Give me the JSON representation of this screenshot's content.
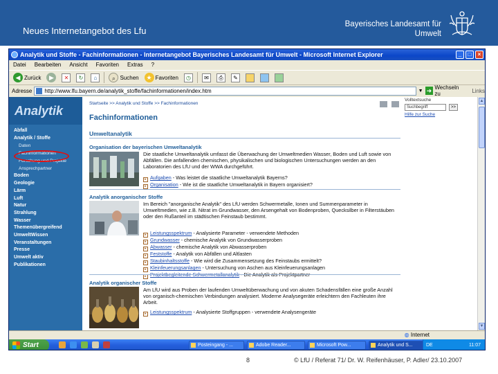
{
  "slide": {
    "title": "Neues Internetangebot des Lfu",
    "org_line1": "Bayerisches Landesamt für",
    "org_line2": "Umwelt",
    "page_number": "8",
    "footer": "© LfU / Referat 71/ Dr. W. Reifenhäuser, P. Adler/ 23.10.2007"
  },
  "browser": {
    "title": "Analytik und Stoffe - Fachinformationen - Internetangebot Bayerisches Landesamt für Umwelt - Microsoft Internet Explorer",
    "menu": [
      "Datei",
      "Bearbeiten",
      "Ansicht",
      "Favoriten",
      "Extras",
      "?"
    ],
    "toolbar": {
      "back": "Zurück",
      "search": "Suchen",
      "favorites": "Favoriten"
    },
    "address_label": "Adresse",
    "address": "http://www.lfu.bayern.de/analytik_stoffe/fachinformationen/index.htm",
    "go_label": "Wechseln zu",
    "links_label": "Links",
    "status_text": "",
    "status_zone": "Internet"
  },
  "page": {
    "nav_brand": "Analytik",
    "nav_items": [
      {
        "label": "Abfall",
        "type": "main"
      },
      {
        "label": "Analytik / Stoffe",
        "type": "main"
      },
      {
        "label": "Daten",
        "type": "sub"
      },
      {
        "label": "Fachinformationen",
        "type": "sub"
      },
      {
        "label": "Forschung und Projekte",
        "type": "sub"
      },
      {
        "label": "Ansprechpartner",
        "type": "sub"
      },
      {
        "label": "Boden",
        "type": "main"
      },
      {
        "label": "Geologie",
        "type": "main"
      },
      {
        "label": "Lärm",
        "type": "main"
      },
      {
        "label": "Luft",
        "type": "main"
      },
      {
        "label": "Natur",
        "type": "main"
      },
      {
        "label": "Strahlung",
        "type": "main"
      },
      {
        "label": "Wasser",
        "type": "main"
      },
      {
        "label": "Themenübergreifend",
        "type": "main"
      },
      {
        "label": "UmweltWissen",
        "type": "main"
      },
      {
        "label": "Veranstaltungen",
        "type": "main"
      },
      {
        "label": "Presse",
        "type": "main"
      },
      {
        "label": "Umwelt aktiv",
        "type": "main"
      },
      {
        "label": "Publikationen",
        "type": "main"
      }
    ],
    "breadcrumb": "Startseite >> Analytik und Stoffe >> Fachinformationen",
    "heading": "Fachinformationen",
    "fulltext_label": "Volltextsuche",
    "fulltext_placeholder": "Suchbegriff",
    "fulltext_button": ">>",
    "fulltext_help": "Hilfe zur Suche",
    "umweltanalytik_title": "Umweltanalytik",
    "sections": [
      {
        "title": "Organisation der bayerischen Umweltanalytik",
        "text": "Die staatliche Umweltanalytik umfasst die Überwachung der Umweltmedien Wasser, Boden und Luft sowie von Abfällen. Die anfallenden chemischen, physikalischen und biologischen Untersuchungen werden an den Laboratorien des LfU und der WWA durchgeführt.",
        "links": [
          {
            "link": "Aufgaben",
            "rest": " - Was leistet die staatliche Umweltanalytik Bayerns?"
          },
          {
            "link": "Organisation",
            "rest": " - Wie ist die staatliche Umweltanalytik in Bayern organisiert?"
          }
        ]
      },
      {
        "title": "Analytik anorganischer Stoffe",
        "text": "Im Bereich \"anorganische Analytik\" des LfU werden Schwermetalle, Ionen und Summenparameter in Umweltmedien, wie z.B. Nitrat im Grundwasser, den Arsengehalt von Bodenproben, Quecksilber in Filterstäuben oder den Rußanteil im städtischen Feinstaub bestimmt.",
        "links": [
          {
            "link": "Leistungsspektrum",
            "rest": " - Analysierte Parameter - verwendete Methoden"
          },
          {
            "link": "Grundwasser",
            "rest": " - chemische Analytik von Grundwasserproben"
          },
          {
            "link": "Abwasser",
            "rest": " - chemische Analytik von Abwasserproben"
          },
          {
            "link": "Feststoffe",
            "rest": " - Analytik von Abfällen und Altlasten"
          },
          {
            "link": "Staubinhaltsstoffe",
            "rest": " - Wie wird die Zusammensetzung des Feinstaubs ermittelt?"
          },
          {
            "link": "Kleinfeuerungsanlagen",
            "rest": " - Untersuchung von Aschen aus Kleinfeuerungsanlagen"
          },
          {
            "link": "Projektbegleitende Schwermetallanalytik",
            "rest": " - Die Analytik als Projektpartner"
          }
        ]
      },
      {
        "title": "Analytik organischer Stoffe",
        "text": "Am LfU wird aus Proben der laufenden Umweltüberwachung und von akuten Schadensfällen eine große Anzahl von organisch-chemischen Verbindungen analysiert. Moderne Analysegeräte erleichtern den Fachleuten ihre Arbeit.",
        "links": [
          {
            "link": "Leistungsspektrum",
            "rest": " - Analysierte Stoffgruppen - verwendete Analysengeräte"
          }
        ]
      }
    ]
  },
  "taskbar": {
    "start": "Start",
    "tasks": [
      "Posteingang - ...",
      "Adobe Reader...",
      "Microsoft Pow...",
      "Analytik und S..."
    ],
    "lang": "DE",
    "clock": "11:07"
  },
  "colors": {
    "slide_header": "#245a9c",
    "nav_blue": "#2a6da9",
    "link_blue": "#1a4ab0",
    "highlight": "#e01010"
  }
}
